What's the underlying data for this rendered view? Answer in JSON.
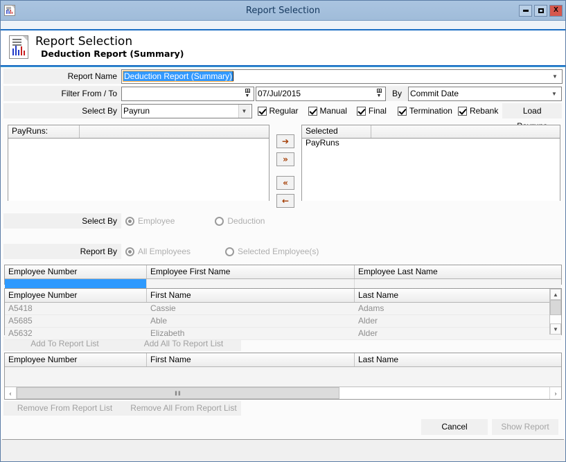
{
  "window": {
    "title": "Report Selection",
    "icon": "report-document-icon",
    "minimize_label": "–",
    "maximize_label": "□",
    "close_label": "X"
  },
  "banner": {
    "icon": "report-document-icon",
    "title": "Report Selection",
    "subtitle": "Deduction Report (Summary)"
  },
  "form": {
    "report_name": {
      "label": "Report Name",
      "value": "Deduction Report (Summary)",
      "dropdown_icon": "chevron-down-icon"
    },
    "filter_from_to": {
      "label": "Filter From / To",
      "from_value": "",
      "to_value": "07/Jul/2015",
      "by_label": "By",
      "by_value": "Commit Date",
      "dropdown_icon": "chevron-down-icon",
      "spinner_icon": "calendar-spinner-icon"
    },
    "select_by_payrun": {
      "label": "Select By",
      "value": "Payrun",
      "dropdown_icon": "chevron-down-icon"
    },
    "checkboxes": [
      {
        "label": "Regular",
        "checked": true
      },
      {
        "label": "Manual",
        "checked": true
      },
      {
        "label": "Final",
        "checked": true
      },
      {
        "label": "Termination",
        "checked": true
      },
      {
        "label": "Rebank",
        "checked": true
      }
    ],
    "load_payruns_label": "Load Payruns"
  },
  "payruns": {
    "available_header": "PayRuns:",
    "selected_header": "Selected PayRuns",
    "available_rows": [],
    "selected_rows": [],
    "transfer_buttons": [
      {
        "name": "move-right-button",
        "glyph": "➔"
      },
      {
        "name": "move-all-right-button",
        "glyph": "»"
      },
      {
        "name": "move-all-left-button",
        "glyph": "«"
      },
      {
        "name": "move-left-button",
        "glyph": "←"
      }
    ]
  },
  "select_by_entity": {
    "label": "Select By",
    "options": [
      {
        "label": "Employee",
        "selected": true
      },
      {
        "label": "Deduction",
        "selected": false
      }
    ]
  },
  "report_by": {
    "label": "Report By",
    "options": [
      {
        "label": "All Employees",
        "selected": true
      },
      {
        "label": "Selected Employee(s)",
        "selected": false
      }
    ]
  },
  "filter_grid": {
    "headers": [
      "Employee Number",
      "Employee First Name",
      "Employee Last Name"
    ],
    "filter_values": [
      "",
      "",
      ""
    ],
    "active_filter_index": 0,
    "active_filter_color": "#2e9afe"
  },
  "employee_grid": {
    "headers": [
      "Employee Number",
      "First Name",
      "Last Name"
    ],
    "rows": [
      {
        "number": "A5418",
        "first": "Cassie",
        "last": "Adams"
      },
      {
        "number": "A5685",
        "first": "Able",
        "last": "Alder"
      },
      {
        "number": "A5632",
        "first": "Elizabeth",
        "last": "Alder"
      }
    ],
    "scroll_up_icon": "chevron-up-icon",
    "scroll_down_icon": "chevron-down-icon"
  },
  "add_buttons": {
    "add_to_report_list": "Add To Report List",
    "add_all_to_report_list": "Add All To Report List"
  },
  "report_list_grid": {
    "headers": [
      "Employee Number",
      "First Name",
      "Last Name"
    ],
    "rows": [],
    "scroll_left_icon": "chevron-left-icon",
    "scroll_right_icon": "chevron-right-icon",
    "thumb_grip": "‖‖"
  },
  "remove_buttons": {
    "remove_from_report_list": "Remove From Report List",
    "remove_all_from_report_list": "Remove All From Report List"
  },
  "actions": {
    "cancel": "Cancel",
    "show_report": "Show Report",
    "show_report_enabled": false
  },
  "statusbar": {
    "text": ""
  },
  "colors": {
    "titlebar": "#a5c0dd",
    "accent_border": "#1c6ec4",
    "close_button": "#d6574d",
    "selection_blue": "#3399ff",
    "arrow_orange": "#a33b00"
  }
}
